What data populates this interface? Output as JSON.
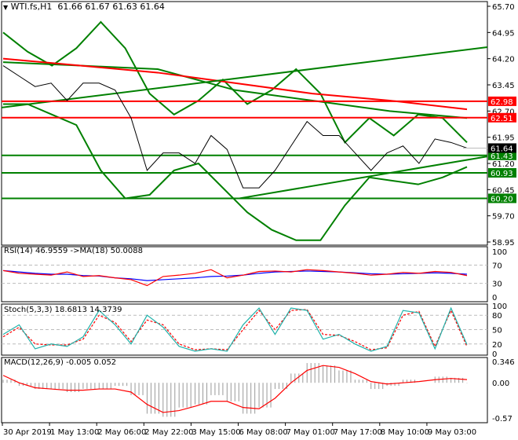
{
  "header": {
    "symbol": "WTI.fs,H1",
    "ohlc": "61.66 61.67 61.63 61.64"
  },
  "colors": {
    "up_line": "#008000",
    "red": "#ff0000",
    "blue": "#0000ff",
    "teal": "#20b2aa",
    "price_tag": "#000000"
  },
  "chart_data": [
    {
      "type": "line",
      "title": "WTI.fs,H1",
      "ylim": [
        58.95,
        65.7
      ],
      "y_ticks": [
        "65.70",
        "64.95",
        "64.20",
        "63.45",
        "62.70",
        "61.95",
        "61.20",
        "60.45",
        "59.70",
        "58.95"
      ],
      "x_ticks": [
        "30 Apr 2019",
        "1 May 13:00",
        "2 May 06:00",
        "2 May 22:00",
        "3 May 15:00",
        "6 May 08:00",
        "7 May 01:00",
        "7 May 17:00",
        "8 May 10:00",
        "9 May 03:00"
      ],
      "close": [
        64.0,
        63.7,
        63.4,
        63.5,
        63.0,
        63.5,
        63.5,
        63.3,
        62.5,
        61.0,
        61.5,
        61.5,
        61.2,
        62.0,
        61.6,
        60.5,
        60.5,
        61.0,
        61.7,
        62.4,
        62.0,
        62.0,
        61.5,
        61.0,
        61.5,
        61.7,
        61.2,
        61.9,
        61.8,
        61.64
      ],
      "bollinger_upper": [
        64.95,
        64.4,
        64.0,
        64.5,
        65.25,
        64.5,
        63.2,
        62.6,
        63.0,
        63.6,
        62.9,
        63.3,
        63.9,
        63.2,
        61.8,
        62.5,
        62.0,
        62.6,
        62.5,
        61.8
      ],
      "bollinger_lower": [
        62.9,
        62.9,
        62.6,
        62.3,
        61.0,
        60.2,
        60.3,
        61.0,
        61.2,
        60.5,
        59.8,
        59.3,
        59.0,
        59.0,
        60.0,
        60.8,
        60.7,
        60.6,
        60.8,
        61.1
      ],
      "ma_slow": [
        64.2,
        64.0,
        63.8,
        63.5,
        63.2,
        63.0,
        62.75
      ],
      "ma_mid": [
        64.1,
        64.0,
        63.9,
        63.3,
        63.0,
        62.7,
        62.5
      ],
      "levels": [
        {
          "value": "62.98",
          "color": "red"
        },
        {
          "value": "62.51",
          "color": "red"
        },
        {
          "value": "61.43",
          "color": "green"
        },
        {
          "value": "60.93",
          "color": "green"
        },
        {
          "value": "60.20",
          "color": "green"
        }
      ],
      "last_price": "61.64",
      "trendlines": [
        {
          "from": 62.8,
          "to": 64.53
        },
        {
          "from": 60.2,
          "to": 61.4
        }
      ]
    },
    {
      "type": "line",
      "title": "RSI(14) 46.9559 ->MA(18) 50.0088",
      "ylim": [
        0,
        100
      ],
      "y_ticks": [
        "100",
        "70",
        "30",
        "0"
      ],
      "rsi": [
        58,
        52,
        50,
        48,
        55,
        45,
        47,
        42,
        38,
        25,
        45,
        48,
        52,
        60,
        42,
        48,
        56,
        57,
        55,
        60,
        58,
        55,
        52,
        48,
        50,
        54,
        52,
        56,
        54,
        47
      ],
      "rsi_ma": [
        58,
        55,
        52,
        50,
        50,
        47,
        46,
        42,
        40,
        36,
        38,
        40,
        42,
        45,
        46,
        48,
        52,
        55,
        56,
        57,
        56,
        55,
        53,
        51,
        50,
        51,
        52,
        53,
        52,
        50
      ]
    },
    {
      "type": "line",
      "title": "Stoch(5,3,3) 18.6813 14.3739",
      "ylim": [
        0,
        100
      ],
      "y_ticks": [
        "100",
        "80",
        "50",
        "20",
        "0"
      ],
      "k": [
        40,
        60,
        10,
        20,
        15,
        35,
        90,
        60,
        20,
        80,
        55,
        15,
        5,
        10,
        5,
        60,
        95,
        40,
        95,
        90,
        30,
        40,
        20,
        5,
        15,
        90,
        85,
        10,
        95,
        18.7
      ],
      "d": [
        35,
        55,
        20,
        18,
        18,
        30,
        80,
        65,
        25,
        70,
        60,
        20,
        8,
        10,
        8,
        50,
        90,
        50,
        90,
        92,
        40,
        38,
        25,
        8,
        12,
        80,
        88,
        15,
        90,
        14.4
      ]
    },
    {
      "type": "bar",
      "title": "MACD(12,26,9) -0.005 0.052",
      "ylim": [
        -0.57,
        0.346
      ],
      "y_ticks": [
        "0.346",
        "0.00",
        "-0.57"
      ],
      "histogram": [
        0.05,
        -0.05,
        -0.1,
        -0.1,
        -0.15,
        -0.1,
        -0.1,
        -0.05,
        -0.2,
        -0.5,
        -0.55,
        -0.4,
        -0.35,
        -0.2,
        -0.3,
        -0.5,
        -0.4,
        -0.1,
        0.15,
        0.32,
        0.28,
        0.2,
        0.05,
        -0.1,
        -0.05,
        0.05,
        0.0,
        0.1,
        0.08,
        -0.005
      ],
      "signal": [
        0.12,
        0.0,
        -0.08,
        -0.1,
        -0.12,
        -0.12,
        -0.1,
        -0.1,
        -0.15,
        -0.35,
        -0.48,
        -0.45,
        -0.38,
        -0.3,
        -0.3,
        -0.4,
        -0.42,
        -0.25,
        0.0,
        0.2,
        0.28,
        0.25,
        0.15,
        0.02,
        -0.02,
        0.0,
        0.02,
        0.05,
        0.07,
        0.052
      ]
    }
  ]
}
